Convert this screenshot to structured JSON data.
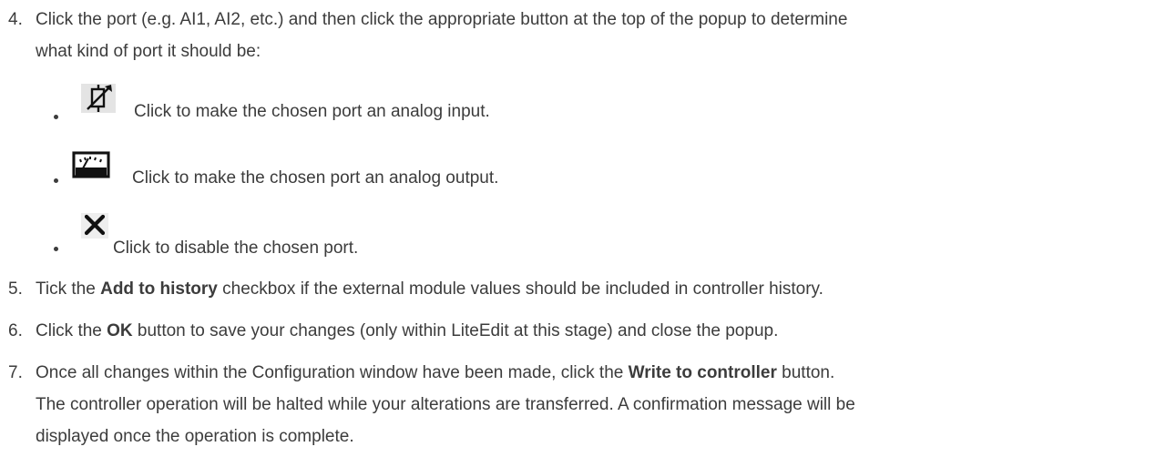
{
  "steps": [
    {
      "number": "4.",
      "lines": [
        "Click the port (e.g. AI1, AI2, etc.) and then click the appropriate button at the top of the popup to determine",
        "what kind of port it should be:"
      ]
    },
    {
      "number": "5.",
      "pre": "Tick the ",
      "bold": "Add to history",
      "post": " checkbox if the external module values should be included in controller history."
    },
    {
      "number": "6.",
      "pre": "Click the ",
      "bold": "OK",
      "post": " button to save your changes (only within LiteEdit at this stage) and close the popup."
    },
    {
      "number": "7.",
      "pre": "Once all changes within the Configuration window have been made, click the ",
      "bold": "Write to controller",
      "post": " button.",
      "lines": [
        "The controller operation will be halted while your alterations are transferred. A confirmation message will be",
        "displayed once the operation is complete."
      ]
    }
  ],
  "bullets": [
    {
      "icon": "analog-input-icon",
      "text": "Click to make the chosen port an analog input."
    },
    {
      "icon": "analog-output-icon",
      "text": "Click to make the chosen port an analog output."
    },
    {
      "icon": "disable-icon",
      "text": "Click to disable the chosen port."
    }
  ]
}
